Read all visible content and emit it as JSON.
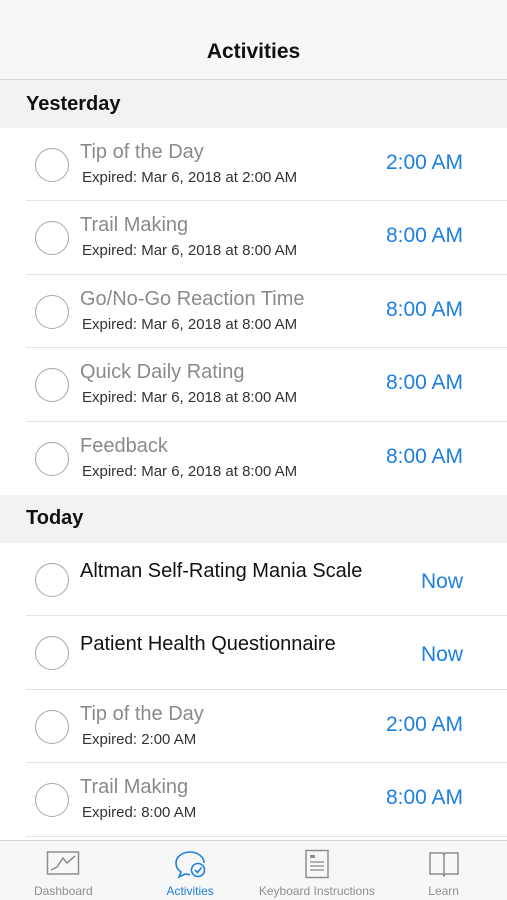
{
  "header": {
    "title": "Activities"
  },
  "sections": [
    {
      "title": "Yesterday",
      "items": [
        {
          "title": "Tip of the Day",
          "subtitle": "Expired: Mar 6, 2018 at 2:00 AM",
          "time": "2:00 AM"
        },
        {
          "title": "Trail Making",
          "subtitle": "Expired: Mar 6, 2018 at 8:00 AM",
          "time": "8:00 AM"
        },
        {
          "title": "Go/No-Go Reaction Time",
          "subtitle": "Expired: Mar 6, 2018 at 8:00 AM",
          "time": "8:00 AM"
        },
        {
          "title": "Quick Daily Rating",
          "subtitle": "Expired: Mar 6, 2018 at 8:00 AM",
          "time": "8:00 AM"
        },
        {
          "title": "Feedback",
          "subtitle": "Expired: Mar 6, 2018 at 8:00 AM",
          "time": "8:00 AM"
        }
      ]
    },
    {
      "title": "Today",
      "items": [
        {
          "title": "Altman Self-Rating Mania Scale",
          "time": "Now"
        },
        {
          "title": "Patient Health Questionnaire",
          "time": "Now"
        },
        {
          "title": "Tip of the Day",
          "subtitle": "Expired: 2:00 AM",
          "time": "2:00 AM"
        },
        {
          "title": "Trail Making",
          "subtitle": "Expired: 8:00 AM",
          "time": "8:00 AM"
        }
      ]
    }
  ],
  "tabbar": {
    "tabs": [
      {
        "label": "Dashboard",
        "icon": "chart-icon",
        "selected": false
      },
      {
        "label": "Activities",
        "icon": "chat-check-icon",
        "selected": true
      },
      {
        "label": "Keyboard Instructions",
        "icon": "document-icon",
        "selected": false
      },
      {
        "label": "Learn",
        "icon": "book-icon",
        "selected": false
      }
    ]
  },
  "colors": {
    "accent": "#1e7fe0",
    "expired_text": "#8a8a8a",
    "section_bg": "#f2f2f2"
  }
}
